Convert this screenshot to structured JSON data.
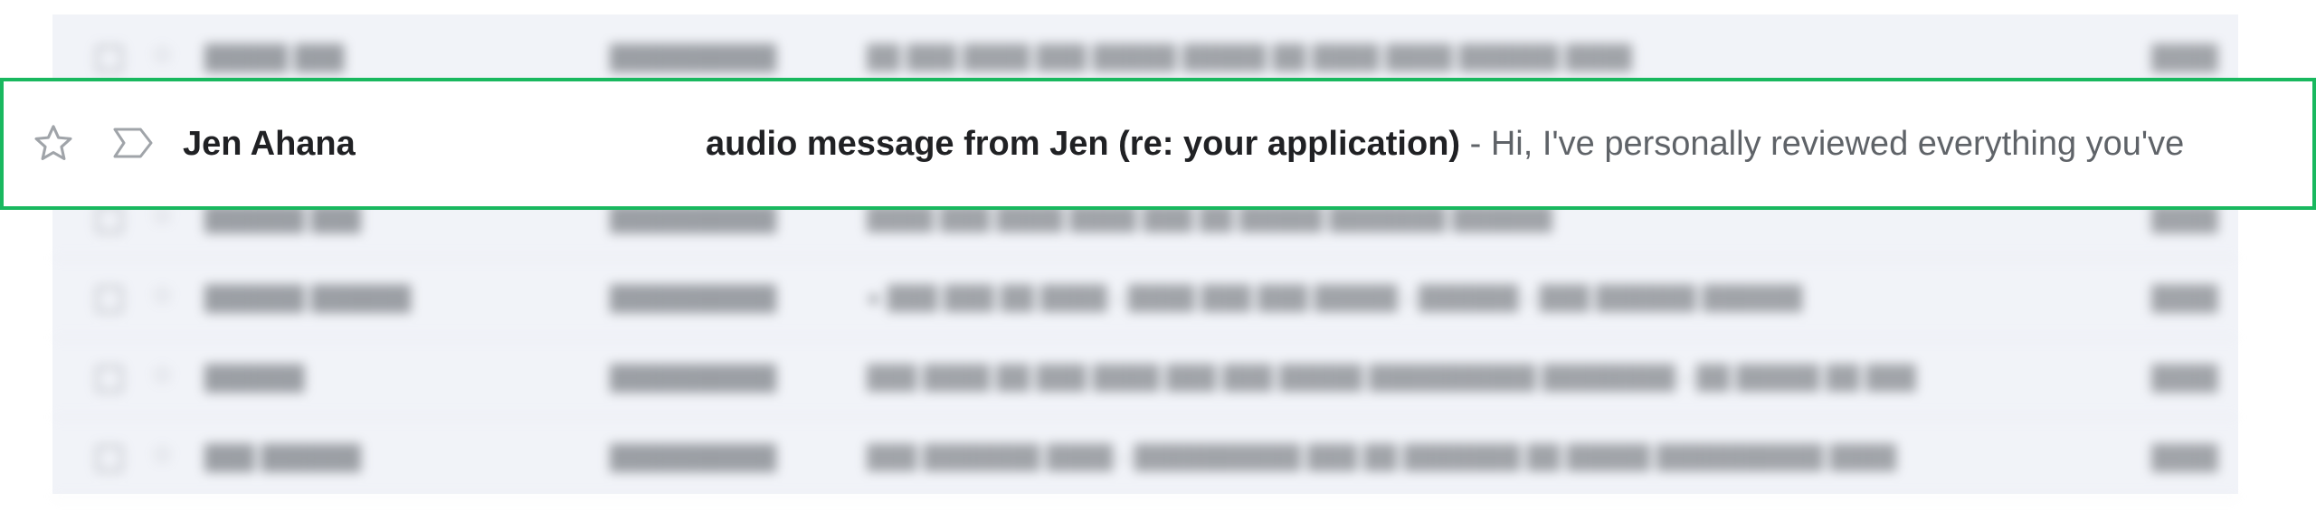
{
  "highlighted_email": {
    "sender": "Jen Ahana",
    "subject": "audio message from Jen (re: your application)",
    "separator": " - ",
    "snippet": "Hi, I've personally reviewed everything you've",
    "star_icon": "star-outline-icon",
    "label_icon": "label-outline-icon"
  },
  "highlight_color": "#19b85f"
}
